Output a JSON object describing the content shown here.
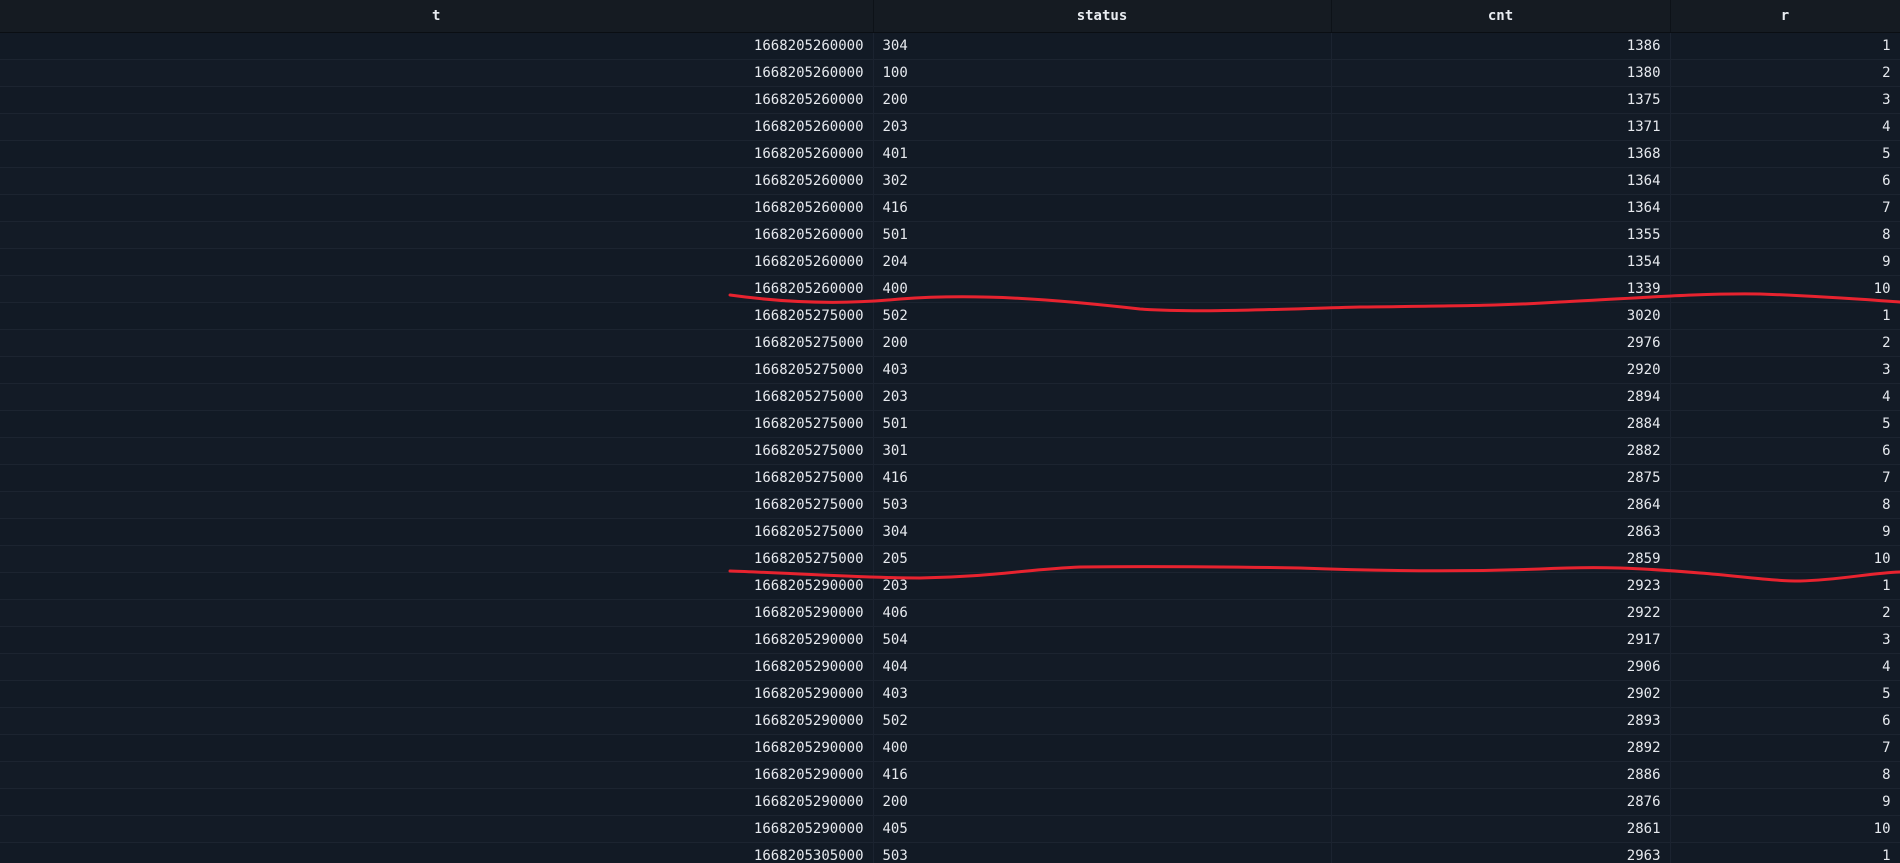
{
  "table": {
    "columns": [
      "t",
      "status",
      "cnt",
      "r"
    ],
    "rows": [
      [
        "1668205260000",
        "304",
        "1386",
        "1"
      ],
      [
        "1668205260000",
        "100",
        "1380",
        "2"
      ],
      [
        "1668205260000",
        "200",
        "1375",
        "3"
      ],
      [
        "1668205260000",
        "203",
        "1371",
        "4"
      ],
      [
        "1668205260000",
        "401",
        "1368",
        "5"
      ],
      [
        "1668205260000",
        "302",
        "1364",
        "6"
      ],
      [
        "1668205260000",
        "416",
        "1364",
        "7"
      ],
      [
        "1668205260000",
        "501",
        "1355",
        "8"
      ],
      [
        "1668205260000",
        "204",
        "1354",
        "9"
      ],
      [
        "1668205260000",
        "400",
        "1339",
        "10"
      ],
      [
        "1668205275000",
        "502",
        "3020",
        "1"
      ],
      [
        "1668205275000",
        "200",
        "2976",
        "2"
      ],
      [
        "1668205275000",
        "403",
        "2920",
        "3"
      ],
      [
        "1668205275000",
        "203",
        "2894",
        "4"
      ],
      [
        "1668205275000",
        "501",
        "2884",
        "5"
      ],
      [
        "1668205275000",
        "301",
        "2882",
        "6"
      ],
      [
        "1668205275000",
        "416",
        "2875",
        "7"
      ],
      [
        "1668205275000",
        "503",
        "2864",
        "8"
      ],
      [
        "1668205275000",
        "304",
        "2863",
        "9"
      ],
      [
        "1668205275000",
        "205",
        "2859",
        "10"
      ],
      [
        "1668205290000",
        "203",
        "2923",
        "1"
      ],
      [
        "1668205290000",
        "406",
        "2922",
        "2"
      ],
      [
        "1668205290000",
        "504",
        "2917",
        "3"
      ],
      [
        "1668205290000",
        "404",
        "2906",
        "4"
      ],
      [
        "1668205290000",
        "403",
        "2902",
        "5"
      ],
      [
        "1668205290000",
        "502",
        "2893",
        "6"
      ],
      [
        "1668205290000",
        "400",
        "2892",
        "7"
      ],
      [
        "1668205290000",
        "416",
        "2886",
        "8"
      ],
      [
        "1668205290000",
        "200",
        "2876",
        "9"
      ],
      [
        "1668205290000",
        "405",
        "2861",
        "10"
      ],
      [
        "1668205305000",
        "503",
        "2963",
        "1"
      ]
    ]
  },
  "annotations": {
    "stroke_color": "#e8232f"
  }
}
